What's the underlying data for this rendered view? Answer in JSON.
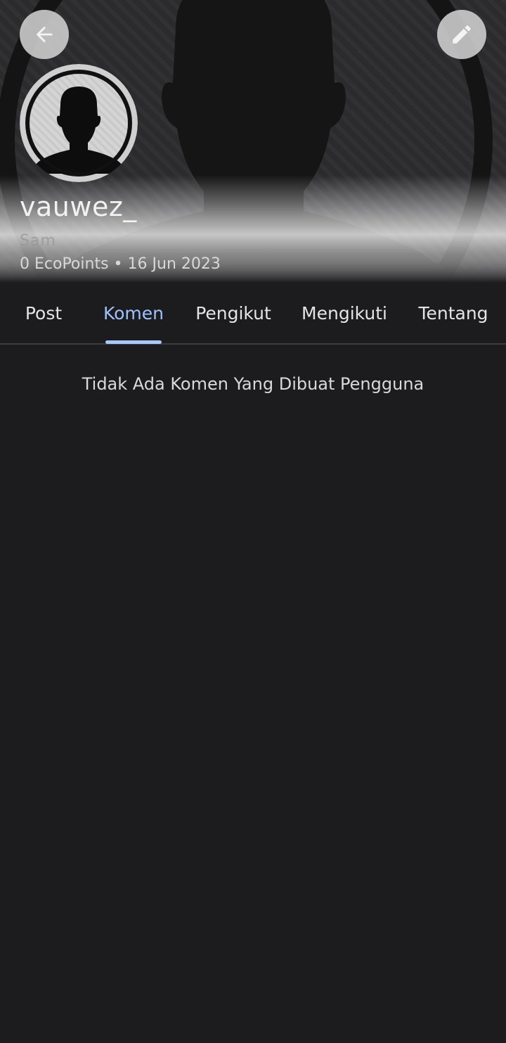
{
  "profile": {
    "username": "vauwez_",
    "display_name": "Sam",
    "ecopoints": "0 EcoPoints",
    "separator": "•",
    "joined_date": "16 Jun 2023"
  },
  "header": {
    "back_icon": "arrow-left-icon",
    "edit_icon": "pencil-icon"
  },
  "tabs": [
    {
      "label": "Post",
      "active": false
    },
    {
      "label": "Komen",
      "active": true
    },
    {
      "label": "Pengikut",
      "active": false
    },
    {
      "label": "Mengikuti",
      "active": false
    },
    {
      "label": "Tentang",
      "active": false
    }
  ],
  "content": {
    "empty_message": "Tidak Ada Komen Yang Dibuat Pengguna"
  },
  "colors": {
    "background": "#1c1c1e",
    "accent": "#9fc2ff",
    "text": "#e4e4e4"
  }
}
